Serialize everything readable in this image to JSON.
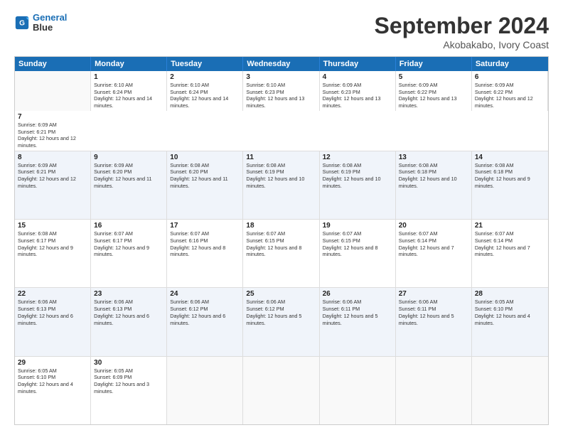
{
  "header": {
    "logo_line1": "General",
    "logo_line2": "Blue",
    "month": "September 2024",
    "location": "Akobakabo, Ivory Coast"
  },
  "days": [
    "Sunday",
    "Monday",
    "Tuesday",
    "Wednesday",
    "Thursday",
    "Friday",
    "Saturday"
  ],
  "rows": [
    [
      {
        "day": "",
        "empty": true
      },
      {
        "day": "1",
        "sunrise": "6:10 AM",
        "sunset": "6:24 PM",
        "daylight": "12 hours and 14 minutes."
      },
      {
        "day": "2",
        "sunrise": "6:10 AM",
        "sunset": "6:24 PM",
        "daylight": "12 hours and 14 minutes."
      },
      {
        "day": "3",
        "sunrise": "6:10 AM",
        "sunset": "6:23 PM",
        "daylight": "12 hours and 13 minutes."
      },
      {
        "day": "4",
        "sunrise": "6:09 AM",
        "sunset": "6:23 PM",
        "daylight": "12 hours and 13 minutes."
      },
      {
        "day": "5",
        "sunrise": "6:09 AM",
        "sunset": "6:22 PM",
        "daylight": "12 hours and 13 minutes."
      },
      {
        "day": "6",
        "sunrise": "6:09 AM",
        "sunset": "6:22 PM",
        "daylight": "12 hours and 12 minutes."
      },
      {
        "day": "7",
        "sunrise": "6:09 AM",
        "sunset": "6:21 PM",
        "daylight": "12 hours and 12 minutes."
      }
    ],
    [
      {
        "day": "8",
        "sunrise": "6:09 AM",
        "sunset": "6:21 PM",
        "daylight": "12 hours and 12 minutes."
      },
      {
        "day": "9",
        "sunrise": "6:09 AM",
        "sunset": "6:20 PM",
        "daylight": "12 hours and 11 minutes."
      },
      {
        "day": "10",
        "sunrise": "6:08 AM",
        "sunset": "6:20 PM",
        "daylight": "12 hours and 11 minutes."
      },
      {
        "day": "11",
        "sunrise": "6:08 AM",
        "sunset": "6:19 PM",
        "daylight": "12 hours and 10 minutes."
      },
      {
        "day": "12",
        "sunrise": "6:08 AM",
        "sunset": "6:19 PM",
        "daylight": "12 hours and 10 minutes."
      },
      {
        "day": "13",
        "sunrise": "6:08 AM",
        "sunset": "6:18 PM",
        "daylight": "12 hours and 10 minutes."
      },
      {
        "day": "14",
        "sunrise": "6:08 AM",
        "sunset": "6:18 PM",
        "daylight": "12 hours and 9 minutes."
      }
    ],
    [
      {
        "day": "15",
        "sunrise": "6:08 AM",
        "sunset": "6:17 PM",
        "daylight": "12 hours and 9 minutes."
      },
      {
        "day": "16",
        "sunrise": "6:07 AM",
        "sunset": "6:17 PM",
        "daylight": "12 hours and 9 minutes."
      },
      {
        "day": "17",
        "sunrise": "6:07 AM",
        "sunset": "6:16 PM",
        "daylight": "12 hours and 8 minutes."
      },
      {
        "day": "18",
        "sunrise": "6:07 AM",
        "sunset": "6:15 PM",
        "daylight": "12 hours and 8 minutes."
      },
      {
        "day": "19",
        "sunrise": "6:07 AM",
        "sunset": "6:15 PM",
        "daylight": "12 hours and 8 minutes."
      },
      {
        "day": "20",
        "sunrise": "6:07 AM",
        "sunset": "6:14 PM",
        "daylight": "12 hours and 7 minutes."
      },
      {
        "day": "21",
        "sunrise": "6:07 AM",
        "sunset": "6:14 PM",
        "daylight": "12 hours and 7 minutes."
      }
    ],
    [
      {
        "day": "22",
        "sunrise": "6:06 AM",
        "sunset": "6:13 PM",
        "daylight": "12 hours and 6 minutes."
      },
      {
        "day": "23",
        "sunrise": "6:06 AM",
        "sunset": "6:13 PM",
        "daylight": "12 hours and 6 minutes."
      },
      {
        "day": "24",
        "sunrise": "6:06 AM",
        "sunset": "6:12 PM",
        "daylight": "12 hours and 6 minutes."
      },
      {
        "day": "25",
        "sunrise": "6:06 AM",
        "sunset": "6:12 PM",
        "daylight": "12 hours and 5 minutes."
      },
      {
        "day": "26",
        "sunrise": "6:06 AM",
        "sunset": "6:11 PM",
        "daylight": "12 hours and 5 minutes."
      },
      {
        "day": "27",
        "sunrise": "6:06 AM",
        "sunset": "6:11 PM",
        "daylight": "12 hours and 5 minutes."
      },
      {
        "day": "28",
        "sunrise": "6:05 AM",
        "sunset": "6:10 PM",
        "daylight": "12 hours and 4 minutes."
      }
    ],
    [
      {
        "day": "29",
        "sunrise": "6:05 AM",
        "sunset": "6:10 PM",
        "daylight": "12 hours and 4 minutes."
      },
      {
        "day": "30",
        "sunrise": "6:05 AM",
        "sunset": "6:09 PM",
        "daylight": "12 hours and 3 minutes."
      },
      {
        "day": "",
        "empty": true
      },
      {
        "day": "",
        "empty": true
      },
      {
        "day": "",
        "empty": true
      },
      {
        "day": "",
        "empty": true
      },
      {
        "day": "",
        "empty": true
      }
    ]
  ],
  "labels": {
    "sunrise": "Sunrise:",
    "sunset": "Sunset:",
    "daylight": "Daylight:"
  }
}
